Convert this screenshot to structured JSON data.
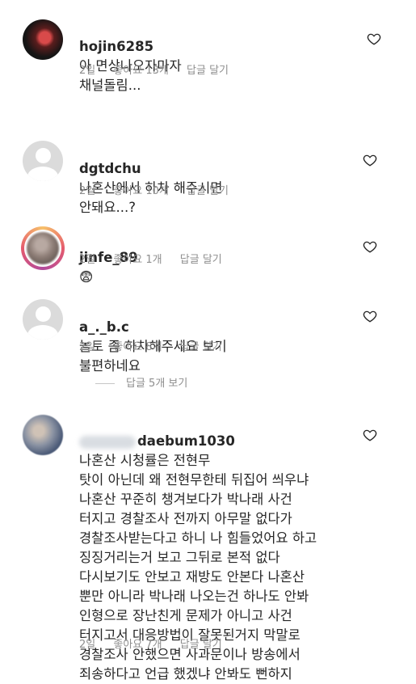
{
  "comments": [
    {
      "username": "hojin6285",
      "text": "아 면상나오자마자\n채널돌림...",
      "time": "2일",
      "likes": "좋아요 13개",
      "reply": "답글 달기",
      "avatar": "dark"
    },
    {
      "username": "dgtdchu",
      "text": "나혼산에서 하차 해주시면\n안돼요...?",
      "time": "2일",
      "likes": "좋아요 10개",
      "reply": "답글 달기",
      "avatar": "default"
    },
    {
      "username": "jinfe_89",
      "text": "😨",
      "time": "2일",
      "likes": "좋아요 1개",
      "reply": "답글 달기",
      "avatar": "story-ring"
    },
    {
      "username": "a_._b.c",
      "text": "놀토 좀 하차해주세요 보기\n불편하네요",
      "time": "2일",
      "likes": "좋아요 8개",
      "reply": "답글 달기",
      "avatar": "default"
    },
    {
      "username": "daebum1030",
      "text": "나혼산 시청률은 전현무\n탓이 아닌데 왜 전현무한테 뒤집어 씌우냐\n나혼산 꾸준히 챙겨보다가 박나래 사건\n터지고 경찰조사 전까지 아무말 없다가\n경찰조사받는다고 하니 나 힘들었어요 하고\n징징거리는거 보고 그뒤로 본적 없다\n다시보기도 안보고 재방도 안본다 나혼산\n뿐만 아니라 박나래 나오는건 하나도 안봐\n인형으로 장난친게 문제가 아니고 사건\n터지고서 대응방법이 잘못된거지 막말로\n경찰조사 안했으면 사과문이나 방송에서\n죄송하다고 언급 했겠냐 안봐도 뻔하지",
      "time": "2일",
      "likes": "좋아요 7개",
      "reply": "답글 달기",
      "avatar": "photo"
    }
  ],
  "view_replies": "답글 5개 보기",
  "icons": {
    "like": "heart-outline-icon"
  },
  "colors": {
    "text": "#262626",
    "secondary": "#8e8e8e",
    "avatar_default": "#dbdbdb"
  }
}
